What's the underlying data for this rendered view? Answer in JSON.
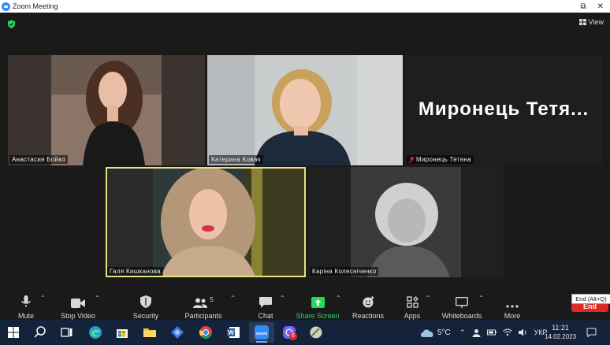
{
  "window": {
    "title": "Zoom Meeting"
  },
  "top_bar": {
    "view_label": "View"
  },
  "participants": [
    {
      "name": "Анастасия Бойко"
    },
    {
      "name": "Катерина Ковач"
    },
    {
      "name": "Миронець Тетяна",
      "big_label": "Миронець  Тетя...",
      "muted": true
    },
    {
      "name": "Галя Кишканова",
      "active_speaker": true
    },
    {
      "name": "Каріна Колесніченко"
    }
  ],
  "toolbar": {
    "mute": "Mute",
    "stop_video": "Stop Video",
    "security": "Security",
    "participants": "Participants",
    "participants_count": "5",
    "chat": "Chat",
    "share_screen": "Share Screen",
    "reactions": "Reactions",
    "apps": "Apps",
    "whiteboards": "Whiteboards",
    "more": "More",
    "end": "End",
    "end_tooltip": "End (Alt+Q)"
  },
  "colors": {
    "share_green": "#23d959",
    "end_red": "#e02828",
    "active_border": "#e9e27c"
  },
  "taskbar": {
    "weather": "5°C",
    "language": "УКР",
    "time": "11:21",
    "date": "14.02.2023",
    "viber_badge": "6"
  }
}
